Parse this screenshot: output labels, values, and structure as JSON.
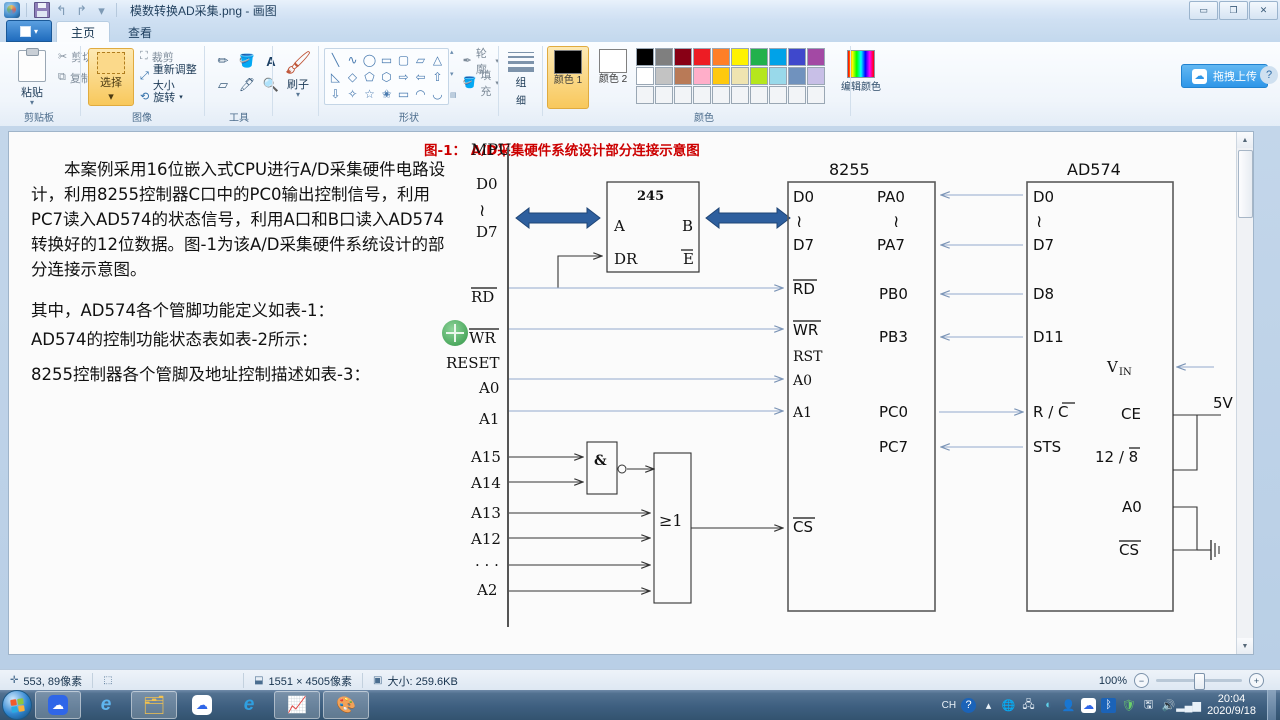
{
  "window": {
    "title": "模数转换AD采集.png - 画图",
    "app_icon": "paint-icon",
    "quick_access": [
      {
        "name": "save-icon",
        "glyph": "save"
      },
      {
        "name": "undo-icon",
        "glyph": "↰"
      },
      {
        "name": "redo-icon",
        "glyph": "↱"
      },
      {
        "name": "customize-qat-icon",
        "glyph": "▾"
      }
    ],
    "controls": [
      {
        "name": "minimize-button",
        "glyph": "▬"
      },
      {
        "name": "maximize-button",
        "glyph": "❐"
      },
      {
        "name": "close-button",
        "glyph": "✕"
      }
    ]
  },
  "tabs": {
    "app_button_label": "",
    "items": [
      {
        "label": "主页",
        "active": true
      },
      {
        "label": "查看",
        "active": false
      }
    ]
  },
  "ribbon": {
    "groups": [
      {
        "label": "剪贴板"
      },
      {
        "label": "图像"
      },
      {
        "label": "工具"
      },
      {
        "label": ""
      },
      {
        "label": "形状"
      },
      {
        "label": ""
      },
      {
        "label": "颜色"
      }
    ],
    "clipboard": {
      "paste_label": "粘贴",
      "cut_label": "剪切",
      "copy_label": "复制",
      "group_label": "剪贴板"
    },
    "image": {
      "select_label": "选择",
      "crop_label": "裁剪",
      "resize_label": "重新调整大小",
      "rotate_label": "旋转",
      "group_label": "图像"
    },
    "tools": {
      "group_label": "工具",
      "icons": [
        "pencil-icon",
        "fill-icon",
        "text-icon",
        "eraser-icon",
        "color-picker-icon",
        "magnifier-icon"
      ]
    },
    "brush": {
      "label": "刷子"
    },
    "shapes": {
      "group_label": "形状",
      "outline_label": "轮廓",
      "fill_label": "填充",
      "glyphs": [
        "╲",
        "∿",
        "◯",
        "▭",
        "▢",
        "▱",
        "△",
        "◺",
        "◇",
        "⬠",
        "⬡",
        "⇨",
        "⇦",
        "⇧",
        "⇩",
        "✧",
        "☆",
        "✬",
        "▭",
        "◠",
        "◡"
      ]
    },
    "thickness": {
      "line1_label": "组",
      "line2_label": "细"
    },
    "colors": {
      "group_label": "颜色",
      "color1_label": "颜色 1",
      "color2_label": "颜色 2",
      "color1_value": "#000000",
      "color2_value": "#ffffff",
      "edit_colors_label": "编辑颜色",
      "row1": [
        "#000000",
        "#7f7f7f",
        "#880015",
        "#ed1c24",
        "#ff7f27",
        "#fff200",
        "#22b14c",
        "#00a2e8",
        "#3f48cc",
        "#a349a4"
      ],
      "row2": [
        "#ffffff",
        "#c3c3c3",
        "#b97a57",
        "#ffaec9",
        "#ffc90e",
        "#efe4b0",
        "#b5e61d",
        "#99d9ea",
        "#7092be",
        "#c8bfe7"
      ],
      "row3": [
        "#f2f4f7",
        "#f2f4f7",
        "#f2f4f7",
        "#f2f4f7",
        "#f2f4f7",
        "#f2f4f7",
        "#f2f4f7",
        "#f2f4f7",
        "#f2f4f7",
        "#f2f4f7"
      ]
    },
    "upload_button": {
      "label": "拖拽上传",
      "logo": "baidu-netdisk-icon"
    }
  },
  "document": {
    "paragraphs": [
      "本案例采用16位嵌入式CPU进行A/D采集硬件电路设计，利用8255控制器C口中的PC0输出控制信号，利用PC7读入AD574的状态信号，利用A口和B口读入AD574转换好的12位数据。图-1为该A/D采集硬件系统设计的部分连接示意图。",
      "其中，AD574各个管脚功能定义如表-1：",
      "AD574的控制功能状态表如表-2所示：",
      "8255控制器各个管脚及地址控制描述如表-3："
    ]
  },
  "diagram": {
    "caption": "图-1： A/D采集硬件系统设计部分连接示意图",
    "caption_color": "#cc0000",
    "mpu": {
      "title": "MPU",
      "pins": [
        "D0",
        "≀",
        "D7",
        "RD",
        "WR",
        "RESET",
        "A0",
        "A1",
        "A15",
        "A14",
        "A13",
        "A12",
        "· · ·",
        "A2"
      ],
      "overbar_pins": [
        "RD",
        "WR"
      ]
    },
    "chip_245": {
      "title": "245",
      "left_pins": [
        "A",
        "DR"
      ],
      "right_pins": [
        "B",
        "E"
      ],
      "overbar_pins": [
        "E"
      ]
    },
    "gate_and": {
      "symbol": "&"
    },
    "gate_or": {
      "symbol": "≥1"
    },
    "chip_8255": {
      "title": "8255",
      "left_pins": [
        "D0",
        "≀",
        "D7",
        "RD",
        "WR",
        "RST",
        "A0",
        "A1",
        "CS"
      ],
      "right_pins": [
        "PA0",
        "≀",
        "PA7",
        "PB0",
        "PB3",
        "PC0",
        "PC7"
      ],
      "overbar_pins": [
        "RD",
        "WR",
        "CS"
      ]
    },
    "chip_ad574": {
      "title": "AD574",
      "left_pins": [
        "D0",
        "≀",
        "D7",
        "D8",
        "D11",
        "R / C",
        "STS"
      ],
      "right_pins": [
        "V IN",
        "CE",
        "12 / 8",
        "A0",
        "CS"
      ],
      "overbar_pins": [
        "C",
        "8",
        "CS"
      ],
      "power_label": "5V"
    }
  },
  "statusbar": {
    "cursor_pos": "553, 89像素",
    "selection_size": "",
    "image_size": "1551 × 4505像素",
    "file_size": "大小: 259.6KB",
    "zoom_level": "100%",
    "zoom_out": "−",
    "zoom_in": "+"
  },
  "taskbar": {
    "start_label": "",
    "buttons": [
      {
        "name": "taskbar-item-netdisk",
        "glyph": "netdisk"
      },
      {
        "name": "taskbar-item-ie",
        "glyph": "e"
      },
      {
        "name": "taskbar-item-explorer",
        "glyph": "folder"
      },
      {
        "name": "taskbar-item-netdisk2",
        "glyph": "netdisk"
      },
      {
        "name": "taskbar-item-edge",
        "glyph": "e"
      },
      {
        "name": "taskbar-item-app",
        "glyph": "chart"
      },
      {
        "name": "taskbar-item-paint",
        "glyph": "palette"
      }
    ],
    "tray": {
      "ime": "CH",
      "icons": [
        "help-icon",
        "expand-icon",
        "app1-icon",
        "app2-icon",
        "app3-icon",
        "app4-icon",
        "netdisk-icon",
        "bluetooth-icon",
        "security-icon",
        "device-icon",
        "volume-icon",
        "network-icon"
      ],
      "time": "20:04",
      "date": "2020/9/18"
    }
  }
}
